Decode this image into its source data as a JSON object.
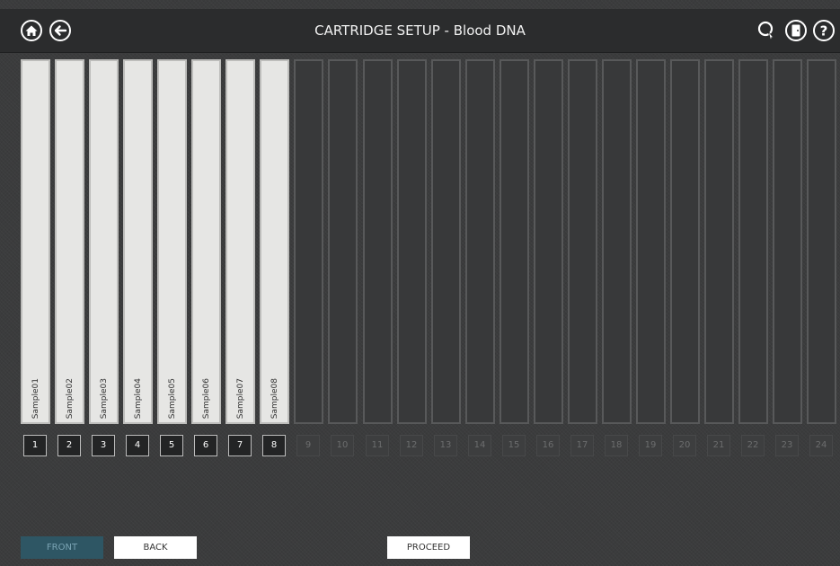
{
  "header": {
    "title": "CARTRIDGE SETUP - Blood DNA",
    "left_icons": [
      "home-icon",
      "back-arrow-icon"
    ],
    "right_icons": [
      "search-pointer-icon",
      "door-exit-icon",
      "help-icon"
    ]
  },
  "cartridge": {
    "samples": [
      "Sample01",
      "Sample02",
      "Sample03",
      "Sample04",
      "Sample05",
      "Sample06",
      "Sample07",
      "Sample08"
    ],
    "positions": [
      "1",
      "2",
      "3",
      "4",
      "5",
      "6",
      "7",
      "8",
      "9",
      "10",
      "11",
      "12",
      "13",
      "14",
      "15",
      "16",
      "17",
      "18",
      "19",
      "20",
      "21",
      "22",
      "23",
      "24"
    ],
    "filled_count": 8
  },
  "footer": {
    "front_label": "FRONT",
    "back_label": "BACK",
    "proceed_label": "PROCEED"
  },
  "colors": {
    "filled_slot": "#e6e6e4",
    "empty_slot": "#38393a",
    "front_button": "#2e5664",
    "topbar": "#2b2c2d"
  }
}
